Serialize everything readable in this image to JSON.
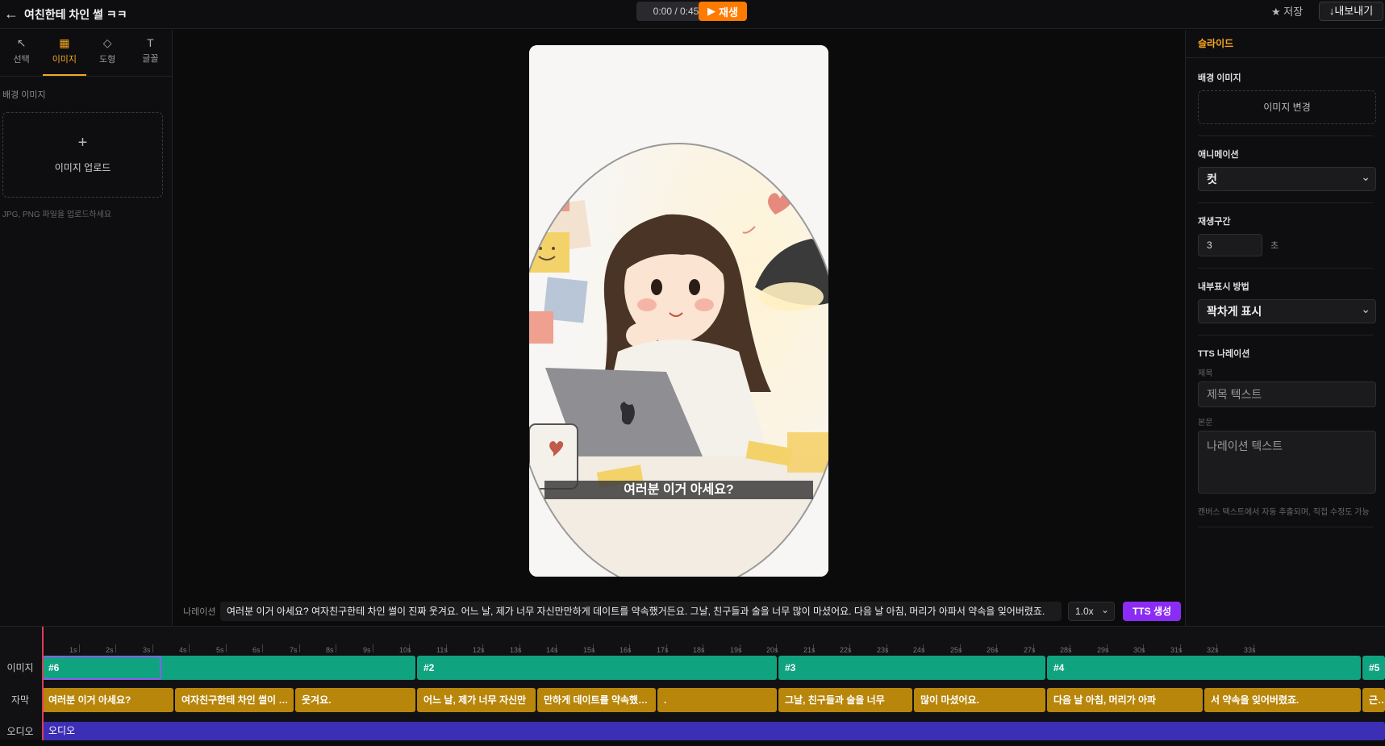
{
  "header": {
    "back_icon": "←",
    "title": "여친한테 차인 썰 ㅋㅋ",
    "time": "0:00 / 0:45",
    "play_label": "재생",
    "save_label": "저장",
    "export_label": "내보내기"
  },
  "tools": [
    {
      "icon": "↖",
      "label": "선택"
    },
    {
      "icon": "🖼",
      "label": "이미지"
    },
    {
      "icon": "◇",
      "label": "도형"
    },
    {
      "icon": "T",
      "label": "글꼴"
    }
  ],
  "left_panel": {
    "section_label": "배경 이미지",
    "upload_plus": "+",
    "upload_label": "이미지 업로드",
    "hint": "JPG, PNG 파일을 업로드하세요"
  },
  "canvas": {
    "subtitle": "여러분 이거 아세요?"
  },
  "narration": {
    "label": "나레이션",
    "text": "여러분 이거 아세요? 여자친구한테 차인 썰이 진짜 웃겨요. 어느 날, 제가 너무 자신만만하게 데이트를 약속했거든요. 그날, 친구들과 술을 너무 많이 마셨어요. 다음 날 아침, 머리가 아파서 약속을 잊어버렸죠.",
    "speed": "1.0x",
    "tts_label": "TTS 생성"
  },
  "right_panel": {
    "header": "슬라이드",
    "bg_image_title": "배경 이미지",
    "change_image_label": "이미지 변경",
    "animation_title": "애니메이션",
    "animation_value": "컷",
    "duration_title": "재생구간",
    "duration_value": "3",
    "duration_unit": "초",
    "display_title": "내부표시 방법",
    "display_value": "꽉차게 표시",
    "tts_title": "TTS 나레이션",
    "subject_label": "제목",
    "subject_placeholder": "제목 텍스트",
    "body_label": "본문",
    "body_placeholder": "나레이션 텍스트",
    "hint": "캔버스 텍스트에서 자동 추출되며, 직접 수정도 가능"
  },
  "timeline": {
    "ruler_labels": [
      "1s",
      "2s",
      "3s",
      "4s",
      "5s",
      "6s",
      "7s",
      "8s",
      "9s",
      "10s",
      "11s",
      "12s",
      "13s",
      "14s",
      "15s",
      "16s",
      "17s",
      "18s",
      "19s",
      "20s",
      "21s",
      "22s",
      "23s",
      "24s",
      "25s",
      "26s",
      "27s",
      "28s",
      "29s",
      "30s",
      "31s",
      "32s",
      "33s"
    ],
    "tracks": {
      "image_label": "이미지",
      "subtitle_label": "자막",
      "audio_label": "오디오"
    },
    "image_clips": [
      "#6",
      "#2",
      "#3",
      "#4",
      "#5"
    ],
    "subtitle_clips": [
      "여러분 이거 아세요?",
      "여자친구한테 차인 썰이 진짜",
      "웃겨요.",
      "어느 날, 제가 너무 자신만",
      "만하게 데이트를 약속했거든요.",
      ".",
      "그날, 친구들과 술을 너무",
      "많이 마셨어요.",
      "다음 날 아침, 머리가 아파",
      "서 약속을 잊어버렸죠.",
      "근데"
    ],
    "audio_clip": "오디오"
  },
  "colors": {
    "accent": "#f5a623",
    "play": "#ff7a00",
    "tts": "#8b2cf5",
    "image_clip": "#10a37f",
    "subtitle_clip": "#b8860b",
    "audio_clip": "#3b2fb5"
  }
}
